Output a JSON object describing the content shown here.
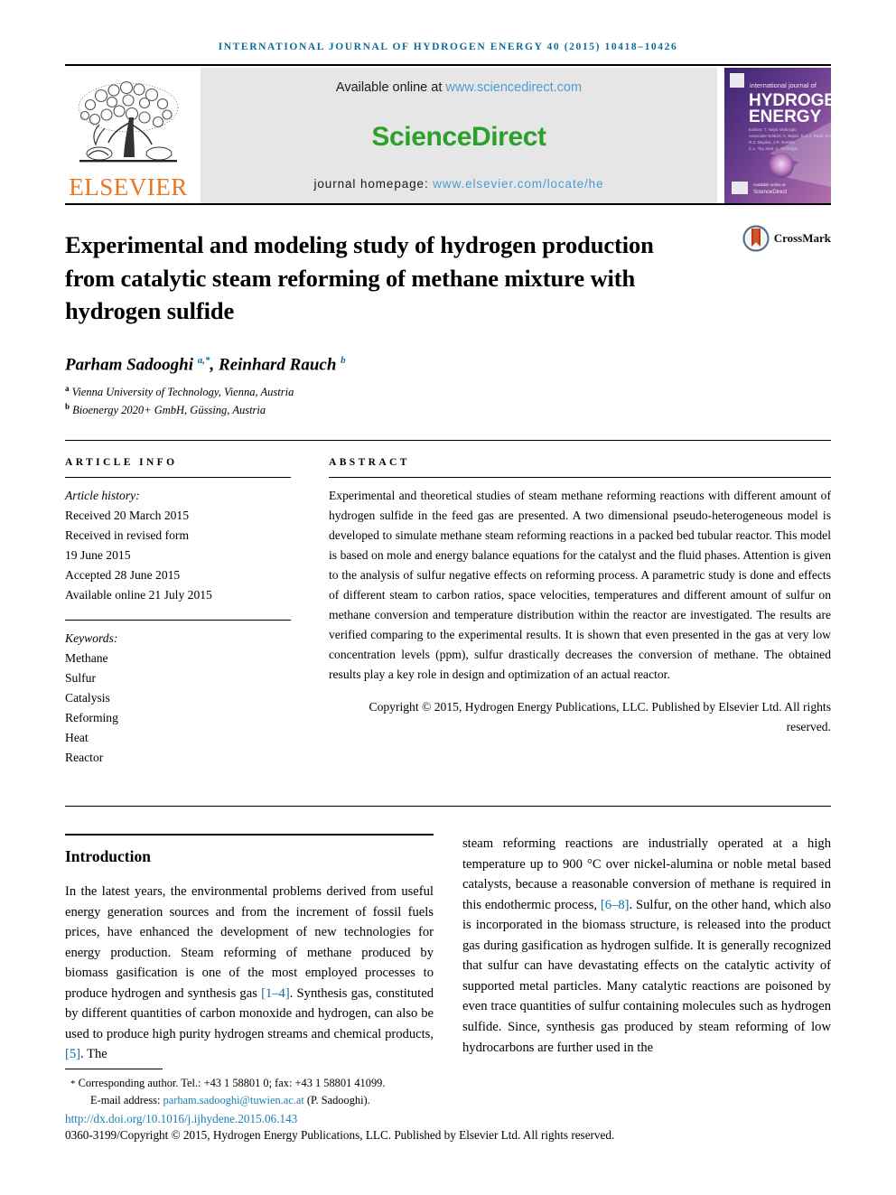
{
  "running_head": "INTERNATIONAL JOURNAL OF HYDROGEN ENERGY 40 (2015) 10418–10426",
  "masthead": {
    "publisher_name": "ELSEVIER",
    "publisher_logo_icon": "elsevier-tree-logo",
    "available_prefix": "Available online at ",
    "sciencedirect_url": "www.sciencedirect.com",
    "sciencedirect_logo": "ScienceDirect",
    "homepage_prefix": "journal homepage: ",
    "homepage_url": "www.elsevier.com/locate/he",
    "cover": {
      "line1": "international journal of",
      "line2": "HYDROGEN",
      "line3": "ENERGY",
      "footer_brand": "ScienceDirect",
      "alt": "International Journal of Hydrogen Energy cover thumbnail"
    }
  },
  "article": {
    "title": "Experimental and modeling study of hydrogen production from catalytic steam reforming of methane mixture with hydrogen sulfide",
    "crossmark_label": "CrossMark",
    "authors_html": "Parham Sadooghi <sup>a,*</sup>, Reinhard Rauch <sup>b</sup>",
    "authors_plain": "Parham Sadooghi a,*, Reinhard Rauch b",
    "affiliations": [
      {
        "marker": "a",
        "text": "Vienna University of Technology, Vienna, Austria"
      },
      {
        "marker": "b",
        "text": "Bioenergy 2020+ GmbH, Güssing, Austria"
      }
    ]
  },
  "article_info": {
    "heading": "ARTICLE INFO",
    "history_label": "Article history:",
    "history": [
      "Received 20 March 2015",
      "Received in revised form",
      "19 June 2015",
      "Accepted 28 June 2015",
      "Available online 21 July 2015"
    ],
    "keywords_label": "Keywords:",
    "keywords": [
      "Methane",
      "Sulfur",
      "Catalysis",
      "Reforming",
      "Heat",
      "Reactor"
    ]
  },
  "abstract": {
    "heading": "ABSTRACT",
    "text": "Experimental and theoretical studies of steam methane reforming reactions with different amount of hydrogen sulfide in the feed gas are presented. A two dimensional pseudo-heterogeneous model is developed to simulate methane steam reforming reactions in a packed bed tubular reactor. This model is based on mole and energy balance equations for the catalyst and the fluid phases. Attention is given to the analysis of sulfur negative effects on reforming process. A parametric study is done and effects of different steam to carbon ratios, space velocities, temperatures and different amount of sulfur on methane conversion and temperature distribution within the reactor are investigated. The results are verified comparing to the experimental results. It is shown that even presented in the gas at very low concentration levels (ppm), sulfur drastically decreases the conversion of methane. The obtained results play a key role in design and optimization of an actual reactor.",
    "copyright": "Copyright © 2015, Hydrogen Energy Publications, LLC. Published by Elsevier Ltd. All rights reserved."
  },
  "introduction": {
    "heading": "Introduction",
    "left_part_1": "In the latest years, the environmental problems derived from useful energy generation sources and from the increment of fossil fuels prices, have enhanced the development of new technologies for energy production. Steam reforming of methane produced by biomass gasification is one of the most employed processes to produce hydrogen and synthesis gas ",
    "ref_1_4": "[1–4]",
    "left_part_2": ". Synthesis gas, constituted by different quantities of carbon monoxide and hydrogen, can also be used to produce high purity hydrogen streams and chemical products, ",
    "ref_5": "[5]",
    "left_part_3": ". The",
    "right_part_1": "steam reforming reactions are industrially operated at a high temperature up to 900 °C over nickel-alumina or noble metal based catalysts, because a reasonable conversion of methane is required in this endothermic process, ",
    "ref_6_8": "[6–8]",
    "right_part_2": ". Sulfur, on the other hand, which also is incorporated in the biomass structure, is released into the product gas during gasification as hydrogen sulfide. It is generally recognized that sulfur can have devastating effects on the catalytic activity of supported metal particles. Many catalytic reactions are poisoned by even trace quantities of sulfur containing molecules such as hydrogen sulfide. Since, synthesis gas produced by steam reforming of low hydrocarbons are further used in the"
  },
  "footnote": {
    "corresponding": "Corresponding author. Tel.: +43 1 58801 0; fax: +43 1 58801 41099.",
    "email_label": "E-mail address: ",
    "email": "parham.sadooghi@tuwien.ac.at",
    "email_suffix": " (P. Sadooghi).",
    "doi": "http://dx.doi.org/10.1016/j.ijhydene.2015.06.143",
    "issn_line": "0360-3199/Copyright © 2015, Hydrogen Energy Publications, LLC. Published by Elsevier Ltd. All rights reserved."
  },
  "colors": {
    "link_blue": "#1a7fb5",
    "runhead_blue": "#0a6d9e",
    "sciencedirect_green": "#2ba02b",
    "sciencedirect_url_blue": "#4a9ed4",
    "elsevier_orange": "#E87722",
    "band_gray": "#e6e6e6"
  }
}
